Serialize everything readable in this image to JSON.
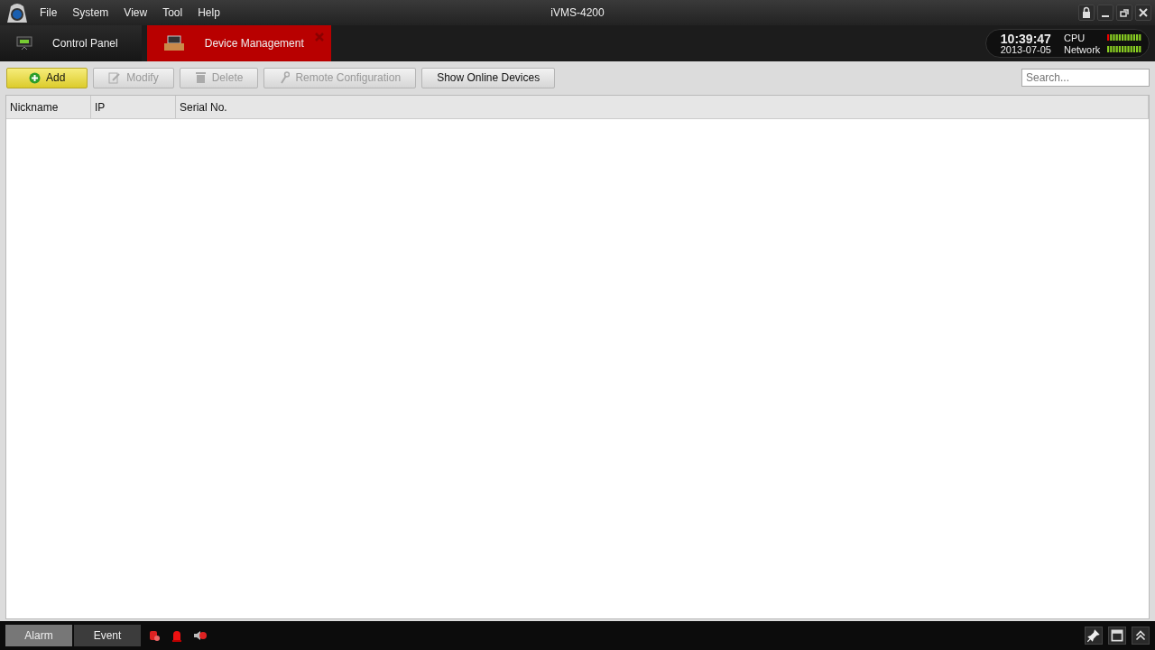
{
  "window": {
    "title": "iVMS-4200"
  },
  "menu": [
    "File",
    "System",
    "View",
    "Tool",
    "Help"
  ],
  "tabs": [
    {
      "label": "Control Panel",
      "selected": false,
      "kind": "panel"
    },
    {
      "label": "Device Management",
      "selected": true,
      "kind": "device"
    }
  ],
  "clock": {
    "time": "10:39:47",
    "date": "2013-07-05"
  },
  "meters": [
    {
      "label": "CPU",
      "alert": true
    },
    {
      "label": "Network",
      "alert": false
    }
  ],
  "toolbar": [
    {
      "label": "Add",
      "kind": "add",
      "disabled": false,
      "highlighted": true
    },
    {
      "label": "Modify",
      "kind": "modify",
      "disabled": true,
      "highlighted": false
    },
    {
      "label": "Delete",
      "kind": "delete",
      "disabled": true,
      "highlighted": false
    },
    {
      "label": "Remote Configuration",
      "kind": "config",
      "disabled": true,
      "highlighted": false
    },
    {
      "label": "Show Online Devices",
      "kind": "plain",
      "disabled": false,
      "highlighted": false
    }
  ],
  "search": {
    "placeholder": "Search..."
  },
  "table": {
    "columns": [
      "Nickname",
      "IP",
      "Serial No."
    ]
  },
  "status_bar": {
    "tabs": [
      {
        "label": "Alarm",
        "selected": true
      },
      {
        "label": "Event",
        "selected": false
      }
    ]
  }
}
